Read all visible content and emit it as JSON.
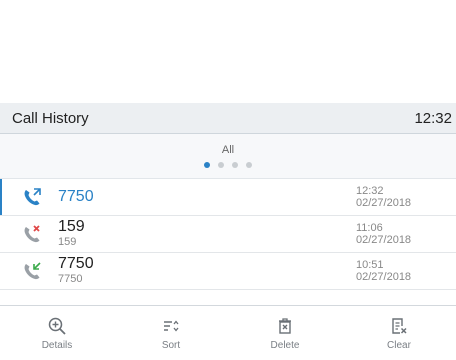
{
  "header": {
    "title": "Call History",
    "clock": "12:32"
  },
  "filter": {
    "label": "All",
    "pages": 4,
    "active_page": 0
  },
  "calls": [
    {
      "type": "outgoing",
      "name": "7750",
      "number": "",
      "time": "12:32",
      "date": "02/27/2018",
      "selected": true
    },
    {
      "type": "missed",
      "name": "159",
      "number": "159",
      "time": "11:06",
      "date": "02/27/2018",
      "selected": false
    },
    {
      "type": "received",
      "name": "7750",
      "number": "7750",
      "time": "10:51",
      "date": "02/27/2018",
      "selected": false
    }
  ],
  "toolbar": {
    "details_label": "Details",
    "sort_label": "Sort",
    "delete_label": "Delete",
    "clear_label": "Clear"
  },
  "colors": {
    "accent": "#2a82c6",
    "missed": "#e04848",
    "received": "#3aaa4a",
    "phone": "#9aa0a6"
  }
}
